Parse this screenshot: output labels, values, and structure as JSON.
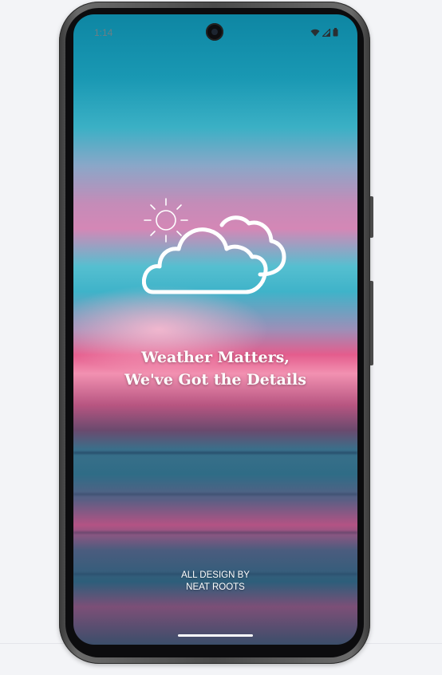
{
  "status_bar": {
    "time": "1:14",
    "icons": [
      "wifi-icon",
      "cellular-signal-icon",
      "battery-icon"
    ]
  },
  "splash": {
    "illustration": [
      "sun-icon",
      "cloud-icon"
    ],
    "headline_line1": "Weather Matters,",
    "headline_line2": "We've Got the Details",
    "credit_line1": "ALL DESIGN BY",
    "credit_line2": "NEAT ROOTS"
  },
  "colors": {
    "page_background": "#f3f4f7",
    "sky_top": "#0e86a3",
    "sunset_pink": "#e45d8d",
    "text": "#ffffff"
  }
}
